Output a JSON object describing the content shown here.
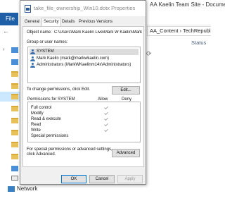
{
  "explorer": {
    "window_title": "AA Kaelin Team Site - Documents",
    "file_tab": "File",
    "path_text": "AA_Content  ›  TechRepublic",
    "status_header": "Status",
    "network_label": "Network"
  },
  "dialog": {
    "title": "take_file_ownership_Win10.dotx Properties",
    "tabs": [
      "General",
      "Security",
      "Details",
      "Previous Versions"
    ],
    "active_tab": "Security",
    "object_name_label": "Object name:",
    "object_name_value": "C:\\Users\\Mark Kaelin Live\\Mark W Kaelin\\Mark",
    "group_label": "Group or user names:",
    "users": [
      {
        "name": "SYSTEM",
        "selected": true
      },
      {
        "name": "Mark Kaelin (mark@markwkaelin.com)",
        "selected": false
      },
      {
        "name": "Administrators (MarkWKaelinm14x\\Administrators)",
        "selected": false
      }
    ],
    "change_perm_text": "To change permissions, click Edit.",
    "edit_button": "Edit...",
    "perm_header": "Permissions for SYSTEM",
    "allow_header": "Allow",
    "deny_header": "Deny",
    "permissions": [
      {
        "name": "Full control",
        "allow": true,
        "deny": false
      },
      {
        "name": "Modify",
        "allow": true,
        "deny": false
      },
      {
        "name": "Read & execute",
        "allow": true,
        "deny": false
      },
      {
        "name": "Read",
        "allow": true,
        "deny": false
      },
      {
        "name": "Write",
        "allow": true,
        "deny": false
      },
      {
        "name": "Special permissions",
        "allow": false,
        "deny": false
      }
    ],
    "advanced_text_line1": "For special permissions or advanced settings,",
    "advanced_text_line2": "click Advanced.",
    "advanced_button": "Advanced",
    "ok_button": "OK",
    "cancel_button": "Cancel",
    "apply_button": "Apply"
  }
}
